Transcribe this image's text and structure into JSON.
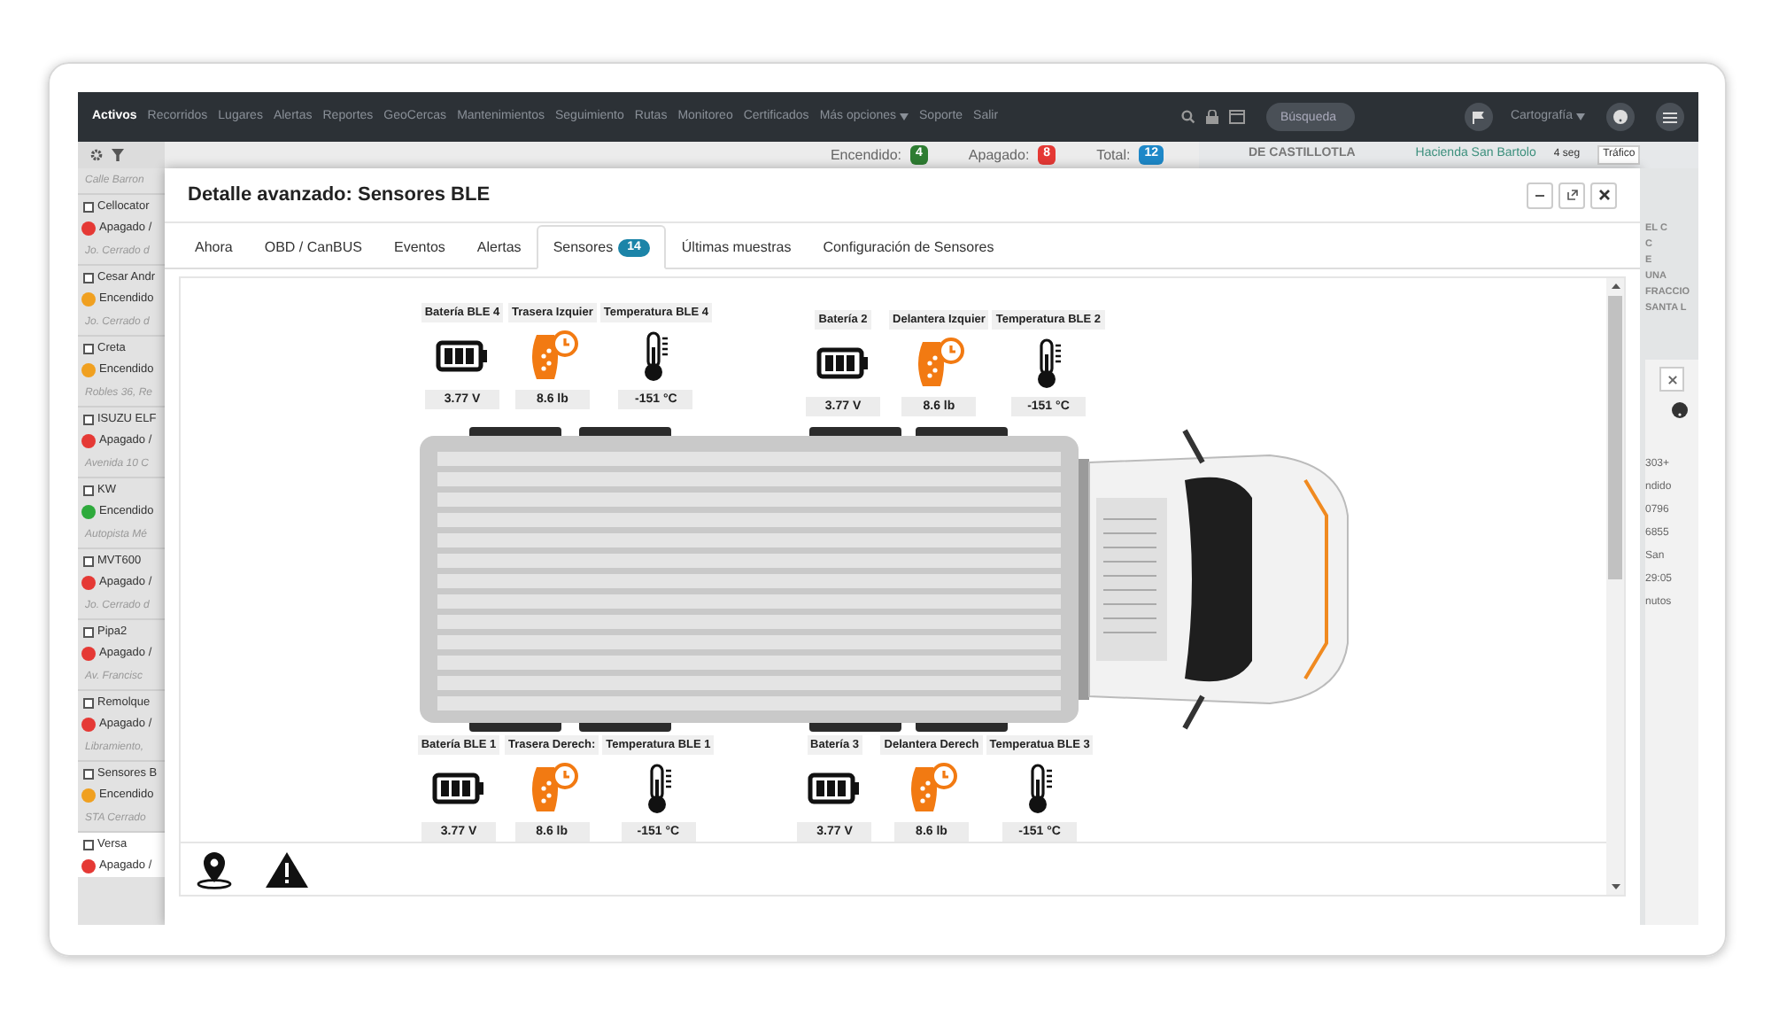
{
  "nav": {
    "items": [
      {
        "label": "Activos",
        "selected": true
      },
      {
        "label": "Recorridos",
        "selected": false
      },
      {
        "label": "Lugares",
        "selected": false
      },
      {
        "label": "Alertas",
        "selected": false
      },
      {
        "label": "Reportes",
        "selected": false
      },
      {
        "label": "GeoCercas",
        "selected": false
      },
      {
        "label": "Mantenimientos",
        "selected": false
      },
      {
        "label": "Seguimiento",
        "selected": false
      },
      {
        "label": "Rutas",
        "selected": false
      },
      {
        "label": "Monitoreo",
        "selected": false
      },
      {
        "label": "Certificados",
        "selected": false
      },
      {
        "label": "Más opciones",
        "selected": false,
        "dropdown": true
      },
      {
        "label": "Soporte",
        "selected": false
      },
      {
        "label": "Salir",
        "selected": false
      }
    ],
    "search_placeholder": "Búsqueda",
    "map_menu": "Cartografía"
  },
  "counts": [
    {
      "label": "Encendido:",
      "value": "4",
      "color": "#2e7d32"
    },
    {
      "label": "Apagado:",
      "value": "8",
      "color": "#e53935"
    },
    {
      "label": "Total:",
      "value": "12",
      "color": "#1e88c8"
    }
  ],
  "map_labels": [
    "DE CASTILLOTLA",
    "Hacienda San Bartolo",
    "4 seg",
    "Tráfico"
  ],
  "map_side_labels": [
    "EL C",
    "C",
    "E",
    "UNA",
    "FRACCIO",
    "SANTA L"
  ],
  "side_panel": [
    "303+",
    "ndido",
    "0796",
    "6855",
    "San",
    "29:05",
    "nutos"
  ],
  "sidebar": {
    "top_address": "Calle Barron",
    "vehicles": [
      {
        "name": "Cellocator",
        "status": "Apagado /",
        "color": "#e53935",
        "address": "Jo. Cerrado d",
        "selected": false
      },
      {
        "name": "Cesar Andr",
        "status": "Encendido",
        "color": "#f0a020",
        "address": "Jo. Cerrado d",
        "selected": false
      },
      {
        "name": "Creta",
        "status": "Encendido",
        "color": "#f0a020",
        "address": "Robles 36, Re",
        "selected": false
      },
      {
        "name": "ISUZU ELF",
        "status": "Apagado /",
        "color": "#e53935",
        "address": "Avenida 10 C",
        "selected": false
      },
      {
        "name": "KW",
        "status": "Encendido",
        "color": "#2eaa3c",
        "address": "Autopista Mé",
        "selected": false
      },
      {
        "name": "MVT600",
        "status": "Apagado /",
        "color": "#e53935",
        "address": "Jo. Cerrado d",
        "selected": false
      },
      {
        "name": "Pipa2",
        "status": "Apagado /",
        "color": "#e53935",
        "address": "Av. Francisc",
        "selected": false
      },
      {
        "name": "Remolque",
        "status": "Apagado /",
        "color": "#e53935",
        "address": "Libramiento,",
        "selected": false
      },
      {
        "name": "Sensores B",
        "status": "Encendido",
        "color": "#f0a020",
        "address": "STA Cerrado",
        "selected": false
      },
      {
        "name": "Versa",
        "status": "Apagado /",
        "color": "#e53935",
        "selected": true
      }
    ]
  },
  "dialog": {
    "title": "Detalle avanzado: Sensores BLE",
    "tabs": [
      {
        "label": "Ahora",
        "selected": false
      },
      {
        "label": "OBD / CanBUS",
        "selected": false
      },
      {
        "label": "Eventos",
        "selected": false
      },
      {
        "label": "Alertas",
        "selected": false
      },
      {
        "label": "Sensores",
        "badge": "14",
        "selected": true
      },
      {
        "label": "Últimas muestras",
        "selected": false
      },
      {
        "label": "Configuración de Sensores",
        "selected": false
      }
    ],
    "top_groups": [
      {
        "sensors": [
          {
            "kind": "battery",
            "label": "Batería BLE 4",
            "value": "3.77 V"
          },
          {
            "kind": "tire",
            "label": "Trasera Izquier",
            "value": "8.6 lb"
          },
          {
            "kind": "temperature",
            "label": "Temperatura BLE 4",
            "value": "-151 °C"
          }
        ]
      },
      {
        "sensors": [
          {
            "kind": "battery",
            "label": "Batería 2",
            "value": "3.77 V"
          },
          {
            "kind": "tire",
            "label": "Delantera Izquier",
            "value": "8.6 lb"
          },
          {
            "kind": "temperature",
            "label": "Temperatura BLE 2",
            "value": "-151 °C"
          }
        ]
      }
    ],
    "bottom_groups": [
      {
        "sensors": [
          {
            "kind": "battery",
            "label": "Batería BLE 1",
            "value": "3.77 V"
          },
          {
            "kind": "tire",
            "label": "Trasera Derech:",
            "value": "8.6 lb"
          },
          {
            "kind": "temperature",
            "label": "Temperatura BLE 1",
            "value": "-151 °C"
          }
        ]
      },
      {
        "sensors": [
          {
            "kind": "battery",
            "label": "Batería 3",
            "value": "3.77 V"
          },
          {
            "kind": "tire",
            "label": "Delantera Derech",
            "value": "8.6 lb"
          },
          {
            "kind": "temperature",
            "label": "Temperatua BLE 3",
            "value": "-151 °C"
          }
        ]
      }
    ]
  }
}
